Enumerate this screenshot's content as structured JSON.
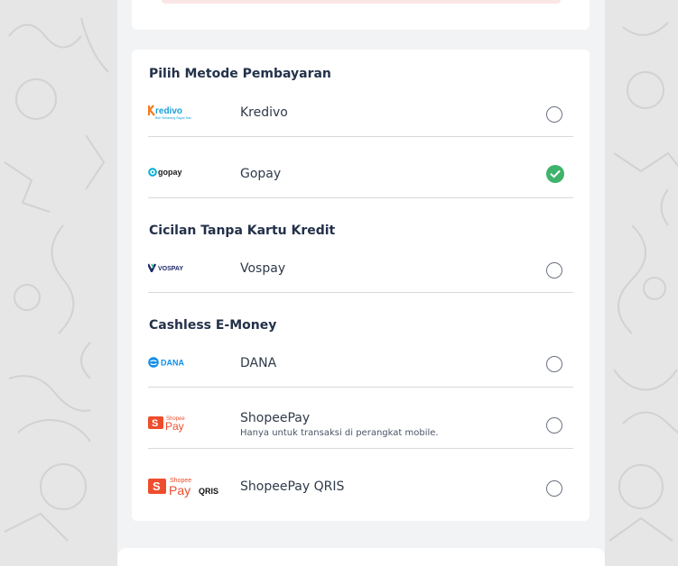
{
  "sections": [
    {
      "title": "Pilih Metode Pembayaran",
      "methods": [
        {
          "name": "Kredivo",
          "logo": "kredivo-logo",
          "tagline": "Beli Sekarang Bayar Nanti",
          "selected": false
        },
        {
          "name": "Gopay",
          "logo": "gopay-logo",
          "selected": true
        }
      ]
    },
    {
      "title": "Cicilan Tanpa Kartu Kredit",
      "methods": [
        {
          "name": "Vospay",
          "logo": "vospay-logo",
          "selected": false
        }
      ]
    },
    {
      "title": "Cashless E-Money",
      "methods": [
        {
          "name": "DANA",
          "logo": "dana-logo",
          "selected": false
        },
        {
          "name": "ShopeePay",
          "note": "Hanya untuk transaksi di perangkat mobile.",
          "logo": "shopeepay-logo",
          "selected": false
        },
        {
          "name": "ShopeePay QRIS",
          "logo": "shopeepay-qris-logo",
          "selected": false
        }
      ]
    }
  ],
  "logos": {
    "kredivo_text": "Kredivo",
    "kredivo_tagline": "Beli Sekarang Bayar Nanti",
    "gopay_text": "gopay",
    "vospay_text": "VOSPAY",
    "dana_text": "DANA",
    "shopee_text": "Shopee",
    "pay_text": "Pay",
    "qris_text": "QRIS"
  },
  "colors": {
    "background": "#e6e6e6",
    "panel": "#f2f3f5",
    "card": "#ffffff",
    "section_title": "#23314a",
    "selected_check": "#3fb36b",
    "divider": "#d7d9dd",
    "shopee_orange": "#ee4d2d",
    "dana_blue": "#118eea",
    "kredivo_orange": "#f47b20",
    "kredivo_blue": "#1b9fd8"
  }
}
